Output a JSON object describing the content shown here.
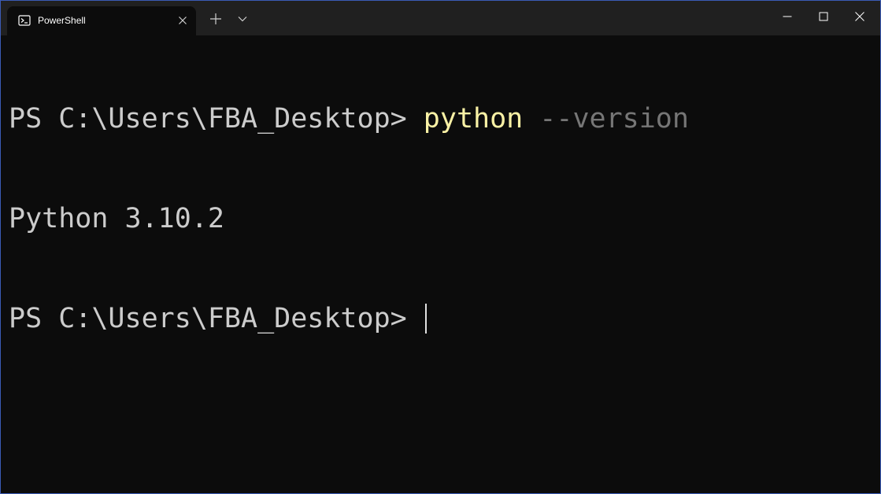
{
  "window": {
    "tab_title": "PowerShell",
    "tab_icon": "powershell-icon",
    "new_tab_icon": "plus-icon",
    "dropdown_icon": "chevron-down-icon",
    "controls": [
      "minimize-icon",
      "maximize-icon",
      "close-icon"
    ]
  },
  "terminal": {
    "line1": {
      "prompt": "PS C:\\Users\\FBA_Desktop> ",
      "command": "python",
      "argument": " --version"
    },
    "line2": {
      "output": "Python 3.10.2"
    },
    "line3": {
      "prompt": "PS C:\\Users\\FBA_Desktop> "
    }
  },
  "colors": {
    "background": "#0c0c0c",
    "titlebar": "#202020",
    "text": "#cccccc",
    "command": "#f9f1a5",
    "argument": "#767676"
  }
}
